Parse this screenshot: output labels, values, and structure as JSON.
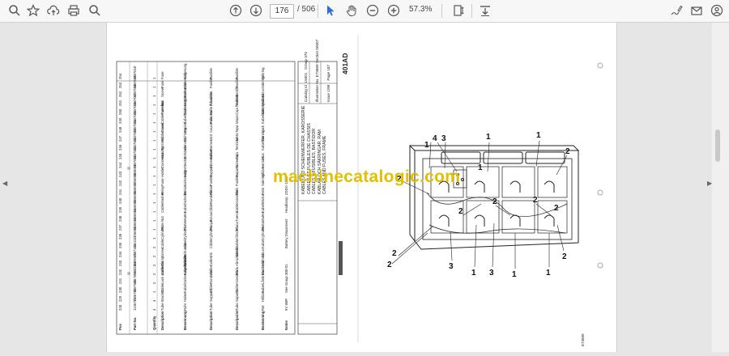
{
  "toolbar": {
    "current_page": "176",
    "total_pages": "/ 506",
    "zoom": "57.3%"
  },
  "watermark": "machinecatalogic.com",
  "document": {
    "title_block": {
      "heading_lines": [
        "KABEL UND SCHEINWERFER, KAROSSERIE",
        "CABLES ET FUSIBLES DE CHASSIS",
        "CABLES Y FUSIBLES, BASTIDOR",
        "KABLAR OCH SÄKRINGAR, RAM",
        "CABLES AND FUSES, FRAME"
      ],
      "catalog_label": "Catalog Id",
      "catalog_value": "15001",
      "group_label": "Group",
      "group_value": "370",
      "illustration_label": "Illustration No.",
      "illustration_value": "E73689",
      "section_label": "Section",
      "section_value": "00007",
      "issue_label": "Issue",
      "issue_value": "1/99",
      "page_label": "Page",
      "page_value": "187",
      "model": "401AD"
    },
    "table": {
      "headers": [
        "Pos",
        "Part No.",
        "Quantity",
        "Description",
        "Benennung",
        "Description",
        "Descripción",
        "Benämning",
        "Notes"
      ],
      "rows": [
        {
          "pos": "228",
          "part": "1136772",
          "qty": "4",
          "desc": "Tube",
          "ben": "Rohr",
          "desc_fr": "Tube",
          "desc_es": "Tubo",
          "sv": "Rör",
          "notes": "5V 6MP"
        },
        {
          "pos": "229",
          "part": "1136790",
          "qty": "4",
          "desc": "Bracket",
          "ben": "Halter",
          "desc_fr": "Support",
          "desc_es": "Soporte",
          "sv": "Hållare",
          "notes": ""
        },
        {
          "pos": "230",
          "part": "1137905",
          "qty": "1",
          "desc": "Cable",
          "ben": "Kabel",
          "desc_fr": "Câble",
          "desc_es": "Cable",
          "sv": "Kabel",
          "notes": "See Group 300-01"
        },
        {
          "pos": "231",
          "part": "11170961",
          "qty": "2",
          "desc": "Lock washer",
          "ben": "Sicherungsscheibe",
          "desc_fr": "Rondelle",
          "desc_es": "Arandela",
          "sv": "Låsbricka",
          "notes": ""
        },
        {
          "pos": "232",
          "part": "1172084",
          "qty": "2",
          "desc": "Cable tie",
          "ben": "Kabelbinder",
          "desc_fr": "Collier",
          "desc_es": "Brida",
          "sv": "Buntband",
          "notes": ""
        },
        {
          "pos": "233",
          "part": "0495579",
          "qty": "2",
          "desc": "Clamp",
          "ben": "Schelle",
          "desc_fr": "Collier",
          "desc_es": "Abrazadera",
          "sv": "Klämma",
          "notes": ""
        },
        {
          "pos": "234",
          "part": "1137131",
          "qty": "2",
          "desc": "Screw",
          "ben": "Schraube",
          "desc_fr": "Vis",
          "desc_es": "Tornillo",
          "sv": "Skruv",
          "notes": ""
        },
        {
          "pos": "235",
          "part": "1161117",
          "qty": "2",
          "desc": "Cable",
          "ben": "Kabel",
          "desc_fr": "Câble",
          "desc_es": "Cable",
          "sv": "Kabel",
          "notes": "Battery Disconnect"
        },
        {
          "pos": "236",
          "part": "1136990",
          "qty": "1",
          "desc": "Cylinder",
          "ben": "Zylinder",
          "desc_fr": "Cylindre",
          "desc_es": "Cilindro",
          "sv": "Cylinder",
          "notes": ""
        },
        {
          "pos": "237",
          "part": "1136993",
          "qty": "1",
          "desc": "Plate",
          "ben": "Platte",
          "desc_fr": "Plaque",
          "desc_es": "Placa",
          "sv": "Platta",
          "notes": ""
        },
        {
          "pos": "238",
          "part": "1136994",
          "qty": "1",
          "desc": "Nut",
          "ben": "Mutter",
          "desc_fr": "Écrou",
          "desc_es": "Tuerca",
          "sv": "Mutter",
          "notes": ""
        },
        {
          "pos": "239",
          "part": "1136995",
          "qty": "1",
          "desc": "Cable",
          "ben": "Kabel",
          "desc_fr": "Câble",
          "desc_es": "Cable",
          "sv": "Kabel",
          "notes": "Headlamp"
        },
        {
          "pos": "240",
          "part": "1136996",
          "qty": "1",
          "desc": "Washer",
          "ben": "Scheibe",
          "desc_fr": "Rondelle",
          "desc_es": "Arandela",
          "sv": "Bricka",
          "notes": ""
        },
        {
          "pos": "241",
          "part": "1136997",
          "qty": "1",
          "desc": "Relay",
          "ben": "Relais",
          "desc_fr": "Relais",
          "desc_es": "Relé",
          "sv": "Relä",
          "notes": "ZDDC-1000"
        },
        {
          "pos": "242",
          "part": "1136998",
          "qty": "1",
          "desc": "Fuse",
          "ben": "Sicherung",
          "desc_fr": "Fusible",
          "desc_es": "Fusible",
          "sv": "Säkring",
          "notes": ""
        },
        {
          "pos": "243",
          "part": "1136999",
          "qty": "1",
          "desc": "Holder",
          "ben": "Halter",
          "desc_fr": "Support",
          "desc_es": "Soporte",
          "sv": "Hållare",
          "notes": ""
        },
        {
          "pos": "244",
          "part": "1137000",
          "qty": "1",
          "desc": "Connector",
          "ben": "Stecker",
          "desc_fr": "Connecteur",
          "desc_es": "Conector",
          "sv": "Kontakt",
          "notes": ""
        },
        {
          "pos": "245",
          "part": "1137001",
          "qty": "1",
          "desc": "Housing",
          "ben": "Gehäuse",
          "desc_fr": "Boîtier",
          "desc_es": "Caja",
          "sv": "Hus",
          "notes": ""
        },
        {
          "pos": "246",
          "part": "1137002",
          "qty": "1",
          "desc": "Terminal",
          "ben": "Klemme",
          "desc_fr": "Borne",
          "desc_es": "Terminal",
          "sv": "Kabelsko",
          "notes": ""
        },
        {
          "pos": "247",
          "part": "1137003",
          "qty": "1",
          "desc": "Rubber seal",
          "ben": "Dichtung",
          "desc_fr": "Joint",
          "desc_es": "Junta",
          "sv": "Tätning",
          "notes": ""
        },
        {
          "pos": "248",
          "part": "1137004",
          "qty": "1",
          "desc": "Cover",
          "ben": "Deckel",
          "desc_fr": "Couvercle",
          "desc_es": "Tapa",
          "sv": "Lock",
          "notes": ""
        },
        {
          "pos": "249",
          "part": "1137005",
          "qty": "1",
          "desc": "Cable harness",
          "ben": "Kabelbaum",
          "desc_fr": "Faisceau",
          "desc_es": "Mazo",
          "sv": "Kabelstam",
          "notes": ""
        },
        {
          "pos": "250",
          "part": "1137006",
          "qty": "1",
          "desc": "Fuse box",
          "ben": "Sicherungskasten",
          "desc_fr": "Boîte à fusibles",
          "desc_es": "Caja fusibles",
          "sv": "Säkringsdosa",
          "notes": ""
        },
        {
          "pos": "251",
          "part": "1137007",
          "qty": "1",
          "desc": "Nut",
          "ben": "Mutter",
          "desc_fr": "Écrou",
          "desc_es": "Tuerca",
          "sv": "Mutter",
          "notes": ""
        },
        {
          "pos": "252",
          "part": "1137008",
          "qty": "1",
          "desc": "Screw",
          "ben": "Schraube",
          "desc_fr": "Vis",
          "desc_es": "Tornillo",
          "sv": "Skruv",
          "notes": ""
        },
        {
          "pos": "253",
          "part": "1137009",
          "qty": "1",
          "desc": "Fuse",
          "ben": "Sicherung",
          "desc_fr": "Fusible",
          "desc_es": "Fusible",
          "sv": "Säkring",
          "notes": ""
        },
        {
          "pos": "254",
          "part": "1137010",
          "qty": "1",
          "desc": "Fuse",
          "ben": "Sicherung",
          "desc_fr": "Fusible",
          "desc_es": "Fusible",
          "sv": "Säkring",
          "notes": ""
        }
      ]
    },
    "drawing": {
      "callouts": [
        "1",
        "1",
        "1",
        "1",
        "1",
        "1",
        "1",
        "2",
        "2",
        "2",
        "2",
        "2",
        "2",
        "2",
        "2",
        "2",
        "3",
        "3",
        "3",
        "4"
      ],
      "figure_code": "E73689"
    }
  }
}
